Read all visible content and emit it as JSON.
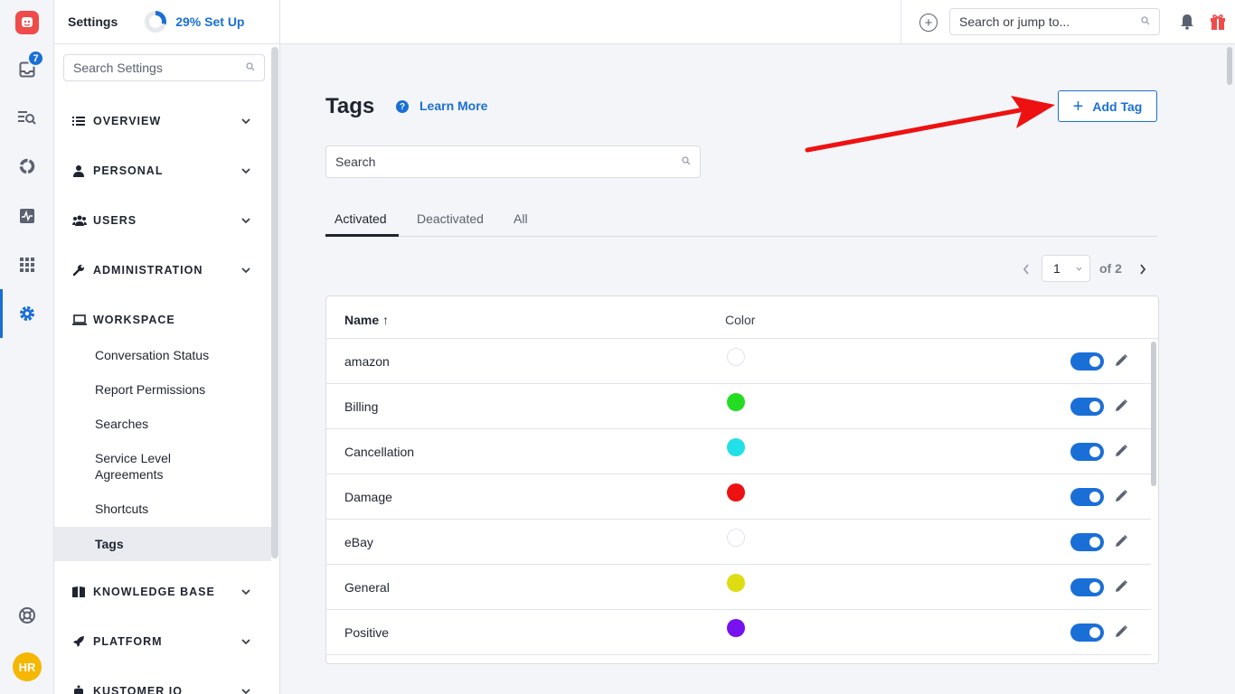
{
  "rail": {
    "inbox_badge": "7",
    "avatar_initials": "HR",
    "icons": [
      "logo-icon",
      "inbox-icon",
      "search-list-icon",
      "reports-icon",
      "activity-icon",
      "apps-grid-icon",
      "settings-gear-icon",
      "help-lifebuoy-icon"
    ]
  },
  "settings": {
    "title": "Settings",
    "setup_label": "29% Set Up",
    "setup_progress": 0.29,
    "search_placeholder": "Search Settings",
    "sections": {
      "overview": "OVERVIEW",
      "personal": "PERSONAL",
      "users": "USERS",
      "administration": "ADMINISTRATION",
      "workspace": "WORKSPACE",
      "knowledge_base": "KNOWLEDGE BASE",
      "platform": "PLATFORM",
      "kustomer_iq": "KUSTOMER IQ"
    },
    "workspace_items": {
      "conversation_status": "Conversation Status",
      "report_permissions": "Report Permissions",
      "searches": "Searches",
      "service_level_agreements": "Service Level Agreements",
      "shortcuts": "Shortcuts",
      "tags": "Tags"
    }
  },
  "topbar": {
    "search_placeholder": "Search or jump to..."
  },
  "main": {
    "title": "Tags",
    "learn_more": "Learn More",
    "add_tag": "Add Tag",
    "search_placeholder": "Search",
    "tabs": {
      "activated": "Activated",
      "deactivated": "Deactivated",
      "all": "All"
    },
    "pagination": {
      "current_page": "1",
      "of_label": "of 2"
    },
    "table": {
      "col_name": "Name ↑",
      "col_color": "Color",
      "rows": [
        {
          "name": "amazon",
          "color": "#ffffff",
          "active": true
        },
        {
          "name": "Billing",
          "color": "#22dd22",
          "active": true
        },
        {
          "name": "Cancellation",
          "color": "#22e0e8",
          "active": true
        },
        {
          "name": "Damage",
          "color": "#ee1111",
          "active": true
        },
        {
          "name": "eBay",
          "color": "#ffffff",
          "active": true
        },
        {
          "name": "General",
          "color": "#dddd11",
          "active": true
        },
        {
          "name": "Positive",
          "color": "#7711ee",
          "active": true
        }
      ]
    }
  },
  "accent_color": "#1a6fd6",
  "annotation_arrow_color": "#ee1111"
}
